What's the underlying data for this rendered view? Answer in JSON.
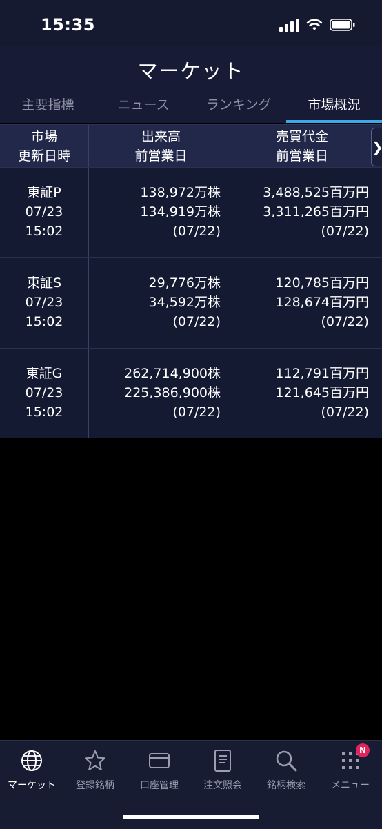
{
  "status_bar": {
    "time": "15:35"
  },
  "header": {
    "title": "マーケット",
    "tabs": [
      {
        "label": "主要指標",
        "active": false
      },
      {
        "label": "ニュース",
        "active": false
      },
      {
        "label": "ランキング",
        "active": false
      },
      {
        "label": "市場概況",
        "active": true
      }
    ]
  },
  "table": {
    "columns": [
      {
        "line1": "市場",
        "line2": "更新日時"
      },
      {
        "line1": "出来高",
        "line2": "前営業日"
      },
      {
        "line1": "売買代金",
        "line2": "前営業日"
      }
    ],
    "scroll_icon": "chevron-right-icon",
    "rows": [
      {
        "market": "東証P",
        "date": "07/23",
        "time": "15:02",
        "volume": "138,972万株",
        "volume_prev": "134,919万株",
        "volume_prev_date": "(07/22)",
        "value": "3,488,525百万円",
        "value_prev": "3,311,265百万円",
        "value_prev_date": "(07/22)"
      },
      {
        "market": "東証S",
        "date": "07/23",
        "time": "15:02",
        "volume": "29,776万株",
        "volume_prev": "34,592万株",
        "volume_prev_date": "(07/22)",
        "value": "120,785百万円",
        "value_prev": "128,674百万円",
        "value_prev_date": "(07/22)"
      },
      {
        "market": "東証G",
        "date": "07/23",
        "time": "15:02",
        "volume": "262,714,900株",
        "volume_prev": "225,386,900株",
        "volume_prev_date": "(07/22)",
        "value": "112,791百万円",
        "value_prev": "121,645百万円",
        "value_prev_date": "(07/22)"
      }
    ]
  },
  "tab_bar": {
    "items": [
      {
        "label": "マーケット",
        "icon": "globe-icon",
        "active": true
      },
      {
        "label": "登録銘柄",
        "icon": "star-icon",
        "active": false
      },
      {
        "label": "口座管理",
        "icon": "card-icon",
        "active": false
      },
      {
        "label": "注文照会",
        "icon": "document-icon",
        "active": false
      },
      {
        "label": "銘柄検索",
        "icon": "search-icon",
        "active": false
      },
      {
        "label": "メニュー",
        "icon": "grid-icon",
        "active": false,
        "badge": "N"
      }
    ]
  },
  "colors": {
    "accent": "#3da8e8",
    "badge": "#e0245e",
    "header_bg": "#171b36",
    "row_bg": "#151a33"
  }
}
